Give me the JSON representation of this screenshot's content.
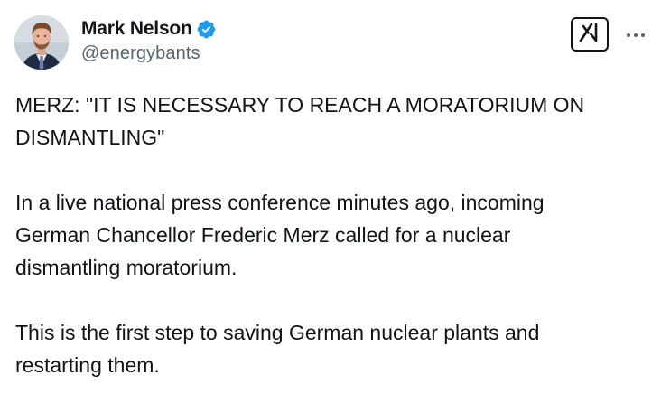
{
  "author": {
    "display_name": "Mark Nelson",
    "handle": "@energybants",
    "verified": true,
    "verified_color": "#1d9bf0"
  },
  "icons": {
    "verified": "verified-badge-icon",
    "grok": "grok-icon",
    "more": "more-icon"
  },
  "post": {
    "paragraphs": [
      "MERZ: \"IT IS NECESSARY TO REACH A MORATORIUM ON\nDISMANTLING\"",
      "In a live national press conference minutes ago, incoming\nGerman Chancellor Frederic Merz called for a nuclear\ndismantling moratorium.",
      "This is the first step to saving German nuclear plants and\nrestarting them."
    ]
  }
}
